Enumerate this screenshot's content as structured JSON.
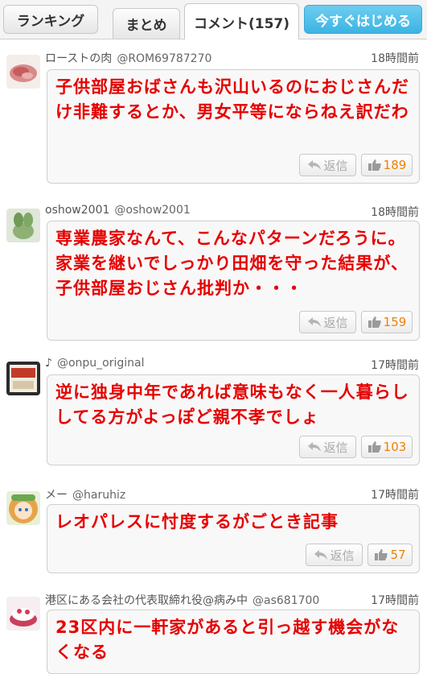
{
  "tabs": {
    "ranking": "ランキング",
    "matome": "まとめ",
    "comment": "コメント(157)",
    "cta": "今すぐはじめる"
  },
  "comments": [
    {
      "name": "ローストの肉",
      "handle": "@ROM69787270",
      "time": "18時間前",
      "text": "子供部屋おばさんも沢山いるのにおじさんだけ非難するとか、男女平等にならねえ訳だわ",
      "reply_label": "返信",
      "likes": "189",
      "avatar_icon": "roast-meat-avatar-icon"
    },
    {
      "name": "oshow2001",
      "handle": "@oshow2001",
      "time": "18時間前",
      "text": "専業農家なんて、こんなパターンだろうに。家業を継いでしっかり田畑を守った結果が、子供部屋おじさん批判か・・・",
      "reply_label": "返信",
      "likes": "159",
      "avatar_icon": "plant-avatar-icon"
    },
    {
      "name": "♪",
      "handle": "@onpu_original",
      "time": "17時間前",
      "text": "逆に独身中年であれば意味もなく一人暮らししてる方がよっぽど親不孝でしょ",
      "reply_label": "返信",
      "likes": "103",
      "avatar_icon": "shop-sign-avatar-icon"
    },
    {
      "name": "メー",
      "handle": "@haruhiz",
      "time": "17時間前",
      "text": "レオパレスに忖度するがごとき記事",
      "reply_label": "返信",
      "likes": "57",
      "avatar_icon": "anime-girl-avatar-icon"
    },
    {
      "name": "港区にある会社の代表取締れ役@病み中",
      "handle": "@as681700",
      "time": "17時間前",
      "text": "23区内に一軒家があると引っ越す機会がなくなる",
      "avatar_icon": "cake-avatar-icon"
    }
  ]
}
